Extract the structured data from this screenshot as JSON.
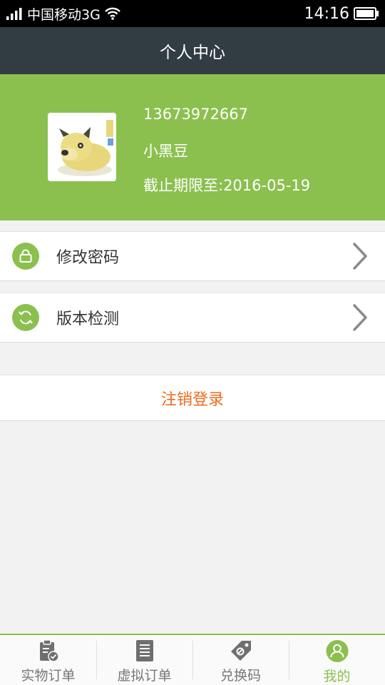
{
  "status_bar": {
    "carrier": "中国移动3G",
    "time": "14:16"
  },
  "nav": {
    "title": "个人中心"
  },
  "profile": {
    "phone": "13673972667",
    "nickname": "小黑豆",
    "expiry": "截止期限至:2016-05-19"
  },
  "menu": [
    {
      "label": "修改密码",
      "icon": "lock-icon"
    },
    {
      "label": "版本检测",
      "icon": "refresh-icon"
    }
  ],
  "logout_label": "注销登录",
  "tabs": [
    {
      "label": "实物订单",
      "icon": "clipboard-check-icon",
      "active": false
    },
    {
      "label": "虚拟订单",
      "icon": "document-icon",
      "active": false
    },
    {
      "label": "兑换码",
      "icon": "tag-icon",
      "active": false
    },
    {
      "label": "我的",
      "icon": "user-icon",
      "active": true
    }
  ],
  "colors": {
    "accent": "#8bc04f",
    "nav_bg": "#323c43",
    "logout": "#f06a1c"
  }
}
